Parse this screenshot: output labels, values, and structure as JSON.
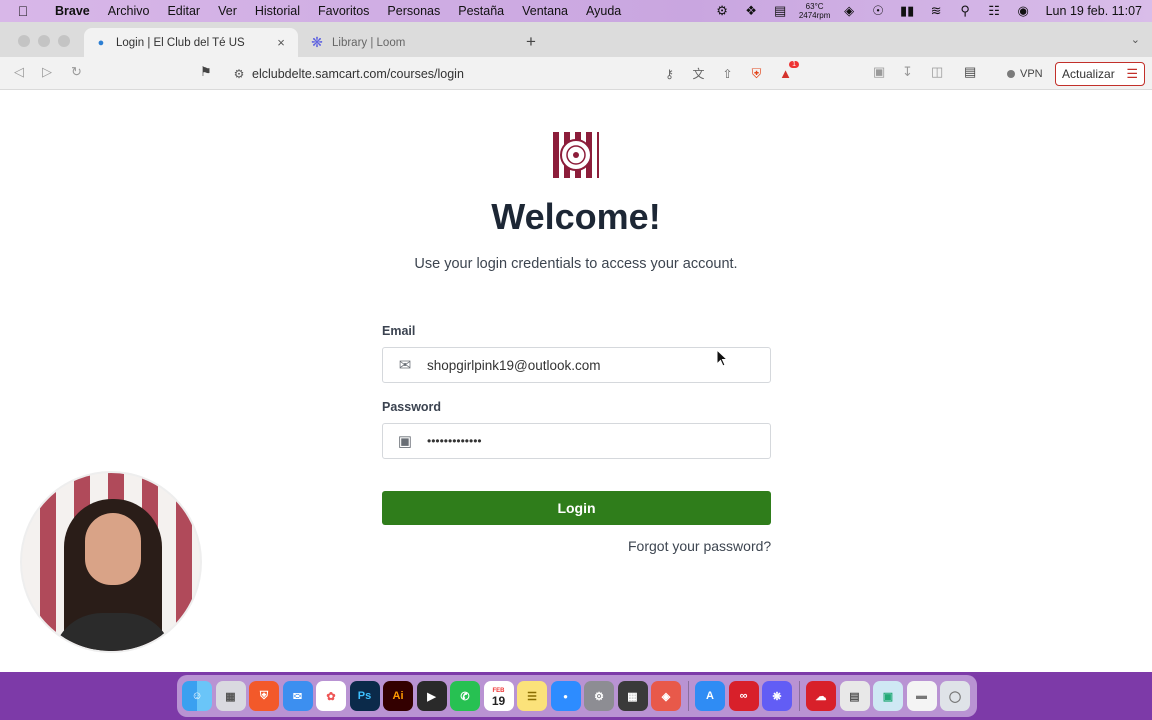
{
  "menubar": {
    "items": [
      "Brave",
      "Archivo",
      "Editar",
      "Ver",
      "Historial",
      "Favoritos",
      "Personas",
      "Pestaña",
      "Ventana",
      "Ayuda"
    ],
    "temp_line1": "63°C",
    "temp_line2": "2474rpm",
    "clock": "Lun 19 feb. 11:07"
  },
  "browser": {
    "tabs": [
      {
        "title": "Login | El Club del Té US",
        "active": true
      },
      {
        "title": "Library | Loom",
        "active": false
      }
    ],
    "url": "elclubdelte.samcart.com/courses/login",
    "vpn_label": "VPN",
    "update_label": "Actualizar",
    "alert_count": "1"
  },
  "page": {
    "title": "Welcome!",
    "subtitle": "Use your login credentials to access your account.",
    "email_label": "Email",
    "email_value": "shopgirlpink19@outlook.com",
    "password_label": "Password",
    "password_value": "•••••••••••••",
    "login_button": "Login",
    "forgot_link": "Forgot your password?"
  },
  "dock": {
    "calendar_month": "FEB",
    "calendar_day": "19",
    "apps": [
      "finder",
      "launchpad",
      "brave",
      "mail",
      "photos",
      "photoshop",
      "illustrator",
      "final-cut",
      "whatsapp",
      "calendar",
      "notes",
      "zoom",
      "system-settings",
      "calculator",
      "affinity",
      "app-store",
      "acrobat",
      "loom",
      "creative-cloud",
      "preview",
      "screenshot-folder",
      "documents",
      "trash"
    ]
  },
  "colors": {
    "login_button": "#2f7d1b",
    "title_text": "#1d2735",
    "logo_maroon": "#8c1d3a"
  }
}
